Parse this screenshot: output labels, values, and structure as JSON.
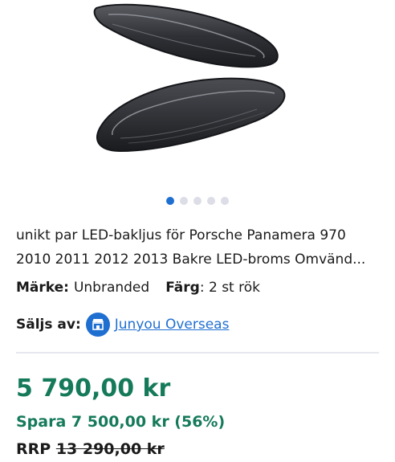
{
  "gallery": {
    "image_alt": "Porsche Panamera LED tail lights pair",
    "dots_count": 5,
    "active_index": 0
  },
  "product": {
    "title": "unikt par LED-bakljus för Porsche Panamera 970 2010 2011 2012 2013 Bakre LED-broms Omvänd...",
    "brand_label": "Märke:",
    "brand_value": "Unbranded",
    "color_label": "Färg",
    "color_value": ": 2 st rök",
    "seller_label": "Säljs av:",
    "seller_name": "Junyou Overseas",
    "seller_icon": "store-icon"
  },
  "pricing": {
    "price": "5 790,00 kr",
    "save": "Spara 7 500,00 kr (56%)",
    "rrp_label": "RRP",
    "rrp_value": "13 290,00 kr"
  },
  "colors": {
    "accent": "#1f6fd1",
    "price_green": "#157a5a"
  }
}
